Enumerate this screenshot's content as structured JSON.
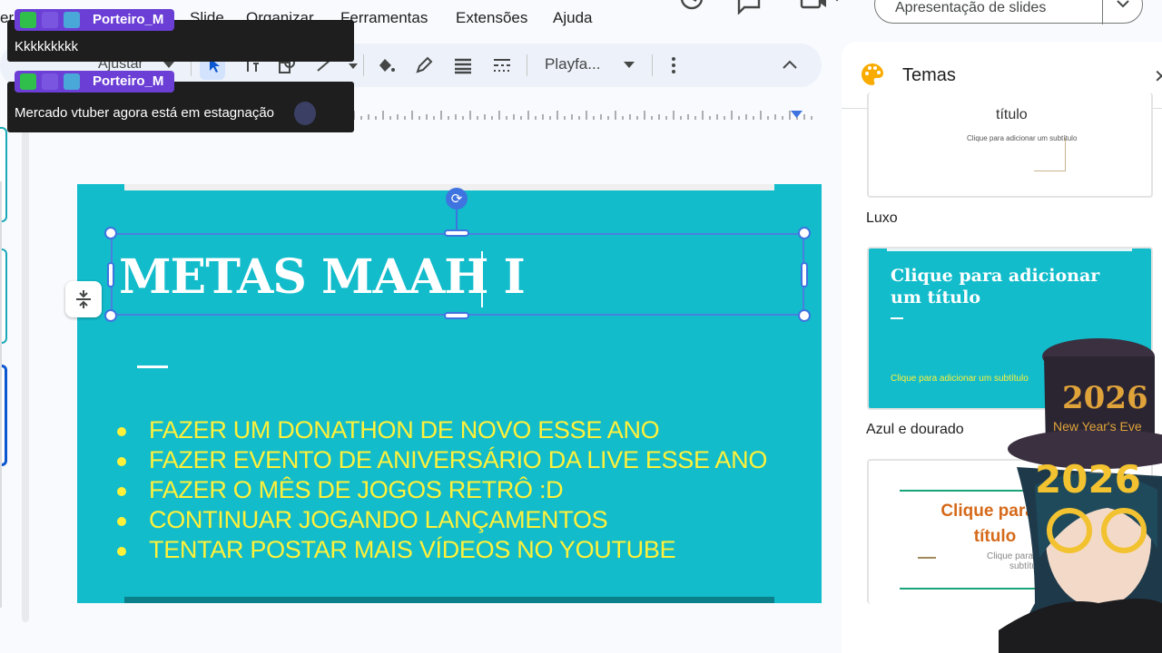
{
  "menubar": {
    "items": [
      "er",
      "r",
      "Slide",
      "Organizar",
      "Ferramentas",
      "Extensões",
      "Ajuda"
    ]
  },
  "present_button": {
    "label": "Apresentação de slides"
  },
  "toolbar": {
    "zoom_label": "Ajustar",
    "font_label": "Playfa..."
  },
  "slide": {
    "title": "METAS MAAH I",
    "bullets": [
      "FAZER UM DONATHON DE NOVO ESSE ANO",
      "FAZER EVENTO DE ANIVERSÁRIO DA LIVE ESSE ANO",
      "FAZER O MÊS DE JOGOS RETRÔ :D",
      "CONTINUAR JOGANDO LANÇAMENTOS",
      "TENTAR POSTAR MAIS VÍDEOS NO YOUTUBE"
    ],
    "colors": {
      "background": "#12bccb",
      "title": "#ffffff",
      "bullets": "#fff13a"
    }
  },
  "themes": {
    "title": "Temas",
    "cards": [
      {
        "name": "Luxo",
        "preview_title": "título",
        "preview_subtitle": "Clique para adicionar um subtítulo"
      },
      {
        "name": "Azul e dourado",
        "preview_title": "Clique para adicionar um título",
        "preview_subtitle": "Clique para adicionar um subtítulo"
      },
      {
        "name": "",
        "preview_title": "Clique para a título",
        "preview_subtitle": "Clique para adicio subtítu"
      }
    ]
  },
  "chat": {
    "messages": [
      {
        "user": "Porteiro_M",
        "text": "Kkkkkkkkk"
      },
      {
        "user": "Porteiro_M",
        "text": "Mercado vtuber agora está em estagnação"
      }
    ]
  },
  "avatar": {
    "hat_text": "2026",
    "hat_subtext": "New Year's Eve",
    "glasses_text": "2026"
  }
}
